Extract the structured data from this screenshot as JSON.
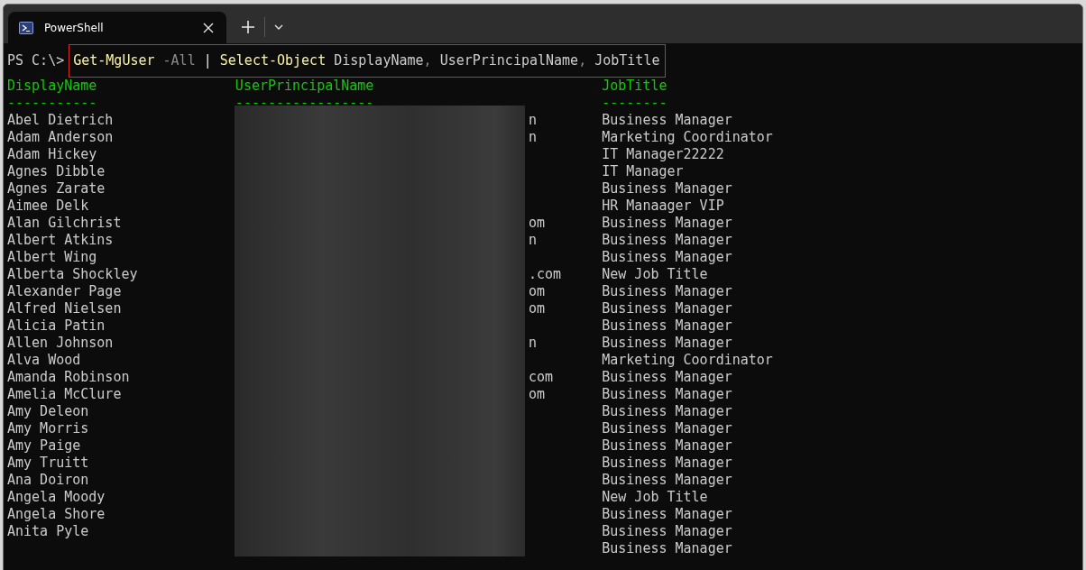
{
  "tabs": [
    {
      "title": "PowerShell",
      "selected": true
    }
  ],
  "command": {
    "prompt": "PS C:\\>",
    "highlighted": true,
    "tokens": [
      {
        "kind": "cmdlet",
        "text": "Get-MgUser"
      },
      {
        "kind": "parameter",
        "text": "-All"
      },
      {
        "kind": "operator",
        "text": "|"
      },
      {
        "kind": "cmdlet",
        "text": "Select-Object"
      },
      {
        "kind": "argument",
        "text": "DisplayName"
      },
      {
        "kind": "separator",
        "text": ","
      },
      {
        "kind": "argument",
        "text": "UserPrincipalName"
      },
      {
        "kind": "separator",
        "text": ","
      },
      {
        "kind": "argument",
        "text": "JobTitle"
      }
    ]
  },
  "table": {
    "columns": [
      {
        "name": "DisplayName",
        "rule": "-----------"
      },
      {
        "name": "UserPrincipalName",
        "rule": "-----------------",
        "redacted": true
      },
      {
        "name": "JobTitle",
        "rule": "--------"
      }
    ],
    "rows": [
      {
        "display_name": "Abel Dietrich",
        "upn_visible": "n",
        "job_title": "Business Manager"
      },
      {
        "display_name": "Adam Anderson",
        "upn_visible": "n",
        "job_title": "Marketing Coordinator"
      },
      {
        "display_name": "Adam Hickey",
        "job_title": "IT Manager22222"
      },
      {
        "display_name": "Agnes Dibble",
        "job_title": "IT Manager"
      },
      {
        "display_name": "Agnes Zarate",
        "job_title": "Business Manager"
      },
      {
        "display_name": "Aimee Delk",
        "job_title": "HR Manaager VIP"
      },
      {
        "display_name": "Alan Gilchrist",
        "upn_visible": "om",
        "job_title": "Business Manager"
      },
      {
        "display_name": "Albert Atkins",
        "upn_visible": "n",
        "job_title": "Business Manager"
      },
      {
        "display_name": "Albert Wing",
        "job_title": "Business Manager"
      },
      {
        "display_name": "Alberta Shockley",
        "upn_visible": ".com",
        "job_title": "New Job Title"
      },
      {
        "display_name": "Alexander Page",
        "upn_visible": "om",
        "job_title": "Business Manager"
      },
      {
        "display_name": "Alfred Nielsen",
        "upn_visible": "om",
        "job_title": "Business Manager"
      },
      {
        "display_name": "Alicia Patin",
        "job_title": "Business Manager"
      },
      {
        "display_name": "Allen Johnson",
        "upn_visible": "n",
        "job_title": "Business Manager"
      },
      {
        "display_name": "Alva Wood",
        "job_title": "Marketing Coordinator"
      },
      {
        "display_name": "Amanda Robinson",
        "upn_visible": "com",
        "job_title": "Business Manager"
      },
      {
        "display_name": "Amelia McClure",
        "upn_visible": "om",
        "job_title": "Business Manager"
      },
      {
        "display_name": "Amy Deleon",
        "job_title": "Business Manager"
      },
      {
        "display_name": "Amy Morris",
        "job_title": "Business Manager"
      },
      {
        "display_name": "Amy Paige",
        "job_title": "Business Manager"
      },
      {
        "display_name": "Amy Truitt",
        "job_title": "Business Manager"
      },
      {
        "display_name": "Ana Doiron",
        "job_title": "Business Manager"
      },
      {
        "display_name": "Angela Moody",
        "job_title": "New Job Title"
      },
      {
        "display_name": "Angela Shore",
        "job_title": "Business Manager"
      },
      {
        "display_name": "Anita Pyle",
        "job_title": "Business Manager"
      },
      {
        "job_title": "Business Manager"
      }
    ]
  }
}
